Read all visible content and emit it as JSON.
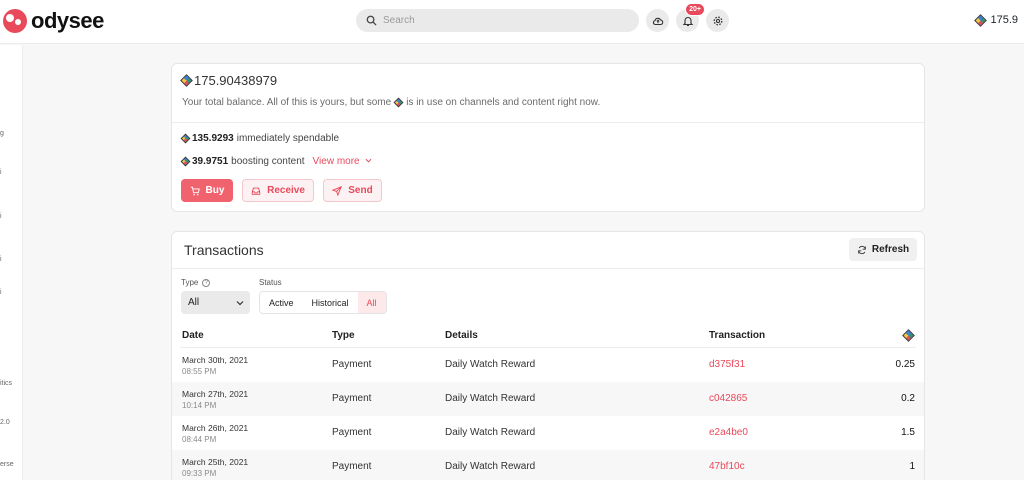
{
  "header": {
    "logo_text": "odysee",
    "search_placeholder": "Search",
    "notification_badge": "20+",
    "balance": "175.9"
  },
  "sidebar": {
    "fragments": [
      "g",
      "i",
      "i",
      "i",
      "i",
      "itics",
      "2.0",
      "erse"
    ]
  },
  "balance_card": {
    "total": "175.90438979",
    "help_before": "Your total balance. All of this is yours, but some",
    "help_after": "is in use on channels and content right now.",
    "spendable_amount": "135.9293",
    "spendable_label": "immediately spendable",
    "boosting_amount": "39.9751",
    "boosting_label": "boosting content",
    "view_more": "View more",
    "buy_label": "Buy",
    "receive_label": "Receive",
    "send_label": "Send"
  },
  "transactions": {
    "title": "Transactions",
    "refresh_label": "Refresh",
    "type_label": "Type",
    "type_value": "All",
    "status_label": "Status",
    "status_options": [
      "Active",
      "Historical",
      "All"
    ],
    "status_selected": "All",
    "columns": [
      "Date",
      "Type",
      "Details",
      "Transaction"
    ],
    "rows": [
      {
        "date": "March 30th, 2021",
        "time": "08:55 PM",
        "type": "Payment",
        "details": "Daily Watch Reward",
        "tx": "d375f31",
        "amount": "0.25"
      },
      {
        "date": "March 27th, 2021",
        "time": "10:14 PM",
        "type": "Payment",
        "details": "Daily Watch Reward",
        "tx": "c042865",
        "amount": "0.2"
      },
      {
        "date": "March 26th, 2021",
        "time": "08:44 PM",
        "type": "Payment",
        "details": "Daily Watch Reward",
        "tx": "e2a4be0",
        "amount": "1.5"
      },
      {
        "date": "March 25th, 2021",
        "time": "09:33 PM",
        "type": "Payment",
        "details": "Daily Watch Reward",
        "tx": "47bf10c",
        "amount": "1"
      }
    ]
  },
  "colors": {
    "accent": "#e8495b",
    "background": "#f7f7f7",
    "card": "#ffffff"
  }
}
